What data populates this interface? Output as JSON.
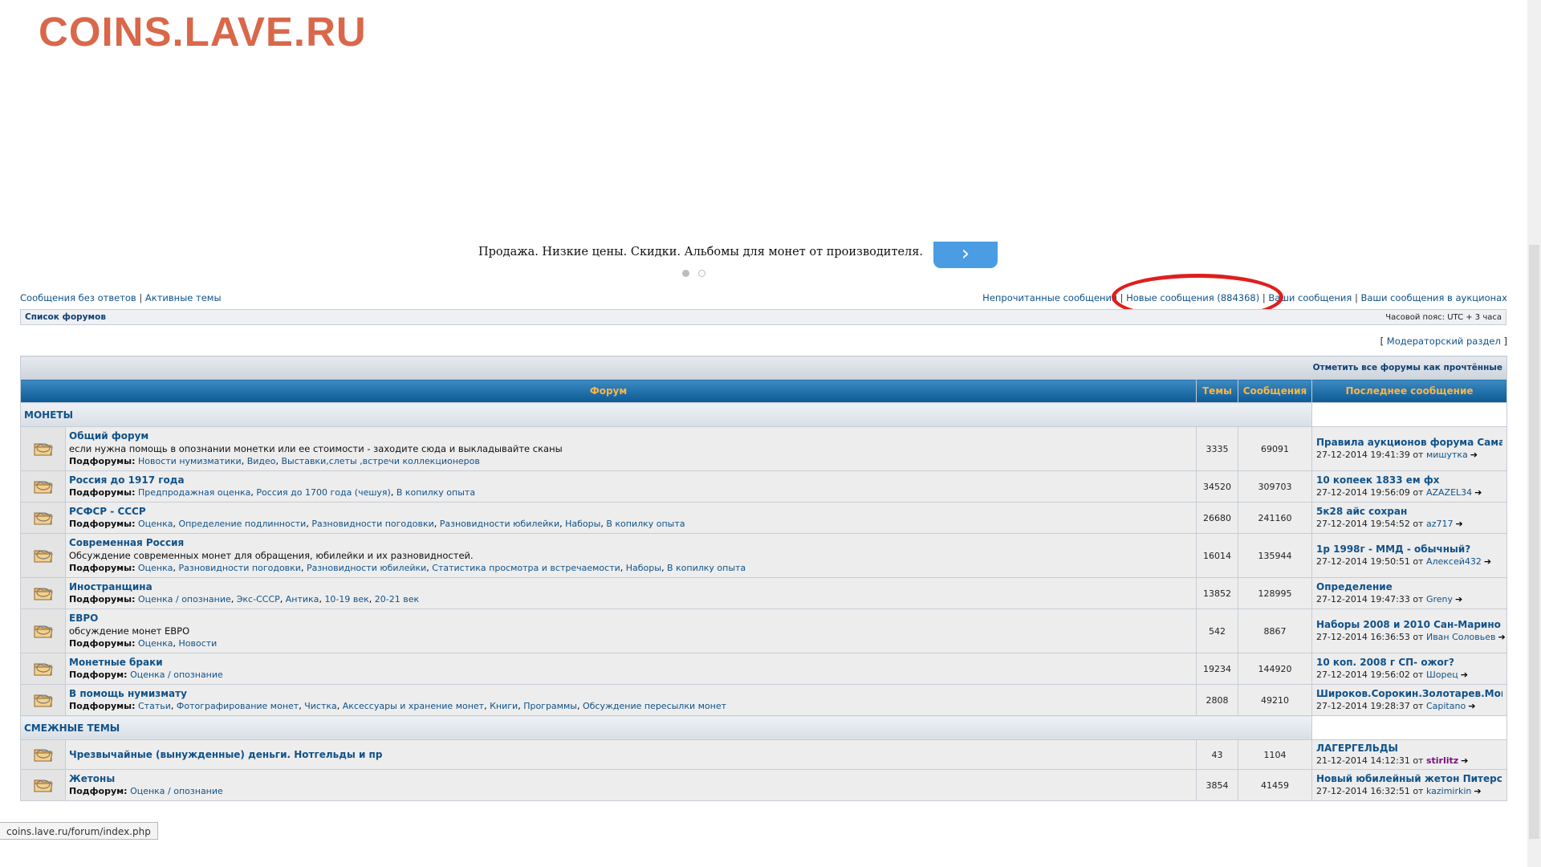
{
  "watermark": "COINS.LAVE.RU",
  "promo": {
    "text": "Продажа. Низкие цены. Скидки. Альбомы для монет от производителя.",
    "button_glyph": "›"
  },
  "links_left": {
    "unanswered": "Сообщения без ответов",
    "active": "Активные темы"
  },
  "links_right": {
    "unread": "Непрочитанные сообщения",
    "new_posts": "Новые сообщения (884368)",
    "your_posts": "Ваши сообщения",
    "your_auction_posts": "Ваши сообщения в аукционах"
  },
  "breadcrumb": "Список форумов",
  "timezone": "Часовой пояс: UTC + 3 часа",
  "moderator": "Модераторский раздел",
  "mark_read": "Отметить все форумы как прочтённые",
  "table_headers": {
    "forum": "Форум",
    "topics": "Темы",
    "posts": "Сообщения",
    "last_post": "Последнее сообщение"
  },
  "categories": [
    {
      "name": "МОНЕТЫ",
      "forums": [
        {
          "title": "Общий форум",
          "desc": "если нужна помощь в опознании монетки или ее стоимости - заходите сюда и выкладывайте сканы",
          "sub_label": "Подфорумы:",
          "subforums": [
            "Новости нумизматики",
            "Видео",
            "Выставки,слеты ,встречи коллекционеров"
          ],
          "topics": "3335",
          "posts": "69091",
          "last_topic": "Правила аукционов форума Самара ...",
          "last_date": "27-12-2014 19:41:39",
          "last_user": "мишутка"
        },
        {
          "title": "Россия до 1917 года",
          "desc": "",
          "sub_label": "Подфорумы:",
          "subforums": [
            "Предпродажная оценка",
            "Россия до 1700 года (чешуя)",
            "В копилку опыта"
          ],
          "topics": "34520",
          "posts": "309703",
          "last_topic": "10 копеек 1833 ем фх",
          "last_date": "27-12-2014 19:56:09",
          "last_user": "AZAZEL34"
        },
        {
          "title": "РСФСР - СССР",
          "desc": "",
          "sub_label": "Подфорумы:",
          "subforums": [
            "Оценка",
            "Определение подлинности",
            "Разновидности погодовки",
            "Разновидности юбилейки",
            "Наборы",
            "В копилку опыта"
          ],
          "topics": "26680",
          "posts": "241160",
          "last_topic": "5к28 айс сохран",
          "last_date": "27-12-2014 19:54:52",
          "last_user": "az717"
        },
        {
          "title": "Современная Россия",
          "desc": "Обсуждение современных монет для обращения, юбилейки и их разновидностей.",
          "sub_label": "Подфорумы:",
          "subforums": [
            "Оценка",
            "Разновидности погодовки",
            "Разновидности юбилейки",
            "Статистика просмотра и встречаемости",
            "Наборы",
            "В копилку опыта"
          ],
          "topics": "16014",
          "posts": "135944",
          "last_topic": "1р 1998г - ММД - обычный?",
          "last_date": "27-12-2014 19:50:51",
          "last_user": "Алексей432"
        },
        {
          "title": "Иностранщина",
          "desc": "",
          "sub_label": "Подфорумы:",
          "subforums": [
            "Оценка / опознание",
            "Экс-СССР",
            "Антика",
            "10-19 век",
            "20-21 век"
          ],
          "topics": "13852",
          "posts": "128995",
          "last_topic": "Определение",
          "last_date": "27-12-2014 19:47:33",
          "last_user": "Greny"
        },
        {
          "title": "ЕВРО",
          "desc": "обсуждение монет ЕВРО",
          "sub_label": "Подфорумы:",
          "subforums": [
            "Оценка",
            "Новости"
          ],
          "topics": "542",
          "posts": "8867",
          "last_topic": "Наборы 2008 и 2010 Сан-Марино",
          "last_date": "27-12-2014 16:36:53",
          "last_user": "Иван Соловьев"
        },
        {
          "title": "Монетные браки",
          "desc": "",
          "sub_label": "Подфорум:",
          "subforums": [
            "Оценка / опознание"
          ],
          "topics": "19234",
          "posts": "144920",
          "last_topic": "10 коп. 2008 г СП- ожог?",
          "last_date": "27-12-2014 19:56:02",
          "last_user": "Шорец"
        },
        {
          "title": "В помощь нумизмату",
          "desc": "",
          "sub_label": "Подфорумы:",
          "subforums": [
            "Статьи",
            "Фотографирование монет",
            "Чистка",
            "Аксессуары и хранение монет",
            "Книги",
            "Программы",
            "Обсуждение пересылки монет"
          ],
          "topics": "2808",
          "posts": "49210",
          "last_topic": "Широков.Сорокин.Золотарев.Монеты...",
          "last_date": "27-12-2014 19:28:37",
          "last_user": "Capitano"
        }
      ]
    },
    {
      "name": "СМЕЖНЫЕ ТЕМЫ",
      "forums": [
        {
          "title": "Чрезвычайные (вынужденные) деньги. Нотгельды и пр",
          "desc": "",
          "sub_label": "",
          "subforums": [],
          "topics": "43",
          "posts": "1104",
          "last_topic": "ЛАГЕРГЕЛЬДЫ",
          "last_date": "21-12-2014 14:12:31",
          "last_user": "stirlitz",
          "last_user_style": "purple"
        },
        {
          "title": "Жетоны",
          "desc": "",
          "sub_label": "Подфорум:",
          "subforums": [
            "Оценка / опознание"
          ],
          "topics": "3854",
          "posts": "41459",
          "last_topic": "Новый юбилейный жетон Питерского...",
          "last_date": "27-12-2014 16:32:51",
          "last_user": "kazimirkin"
        }
      ]
    }
  ],
  "last_by": "от",
  "goto_icon": "goto-last-post-icon",
  "status_url": "coins.lave.ru/forum/index.php",
  "colors": {
    "link": "#105289",
    "header_text": "#ffb545",
    "annotation": "#e01e1e",
    "watermark": "#d9684a"
  }
}
